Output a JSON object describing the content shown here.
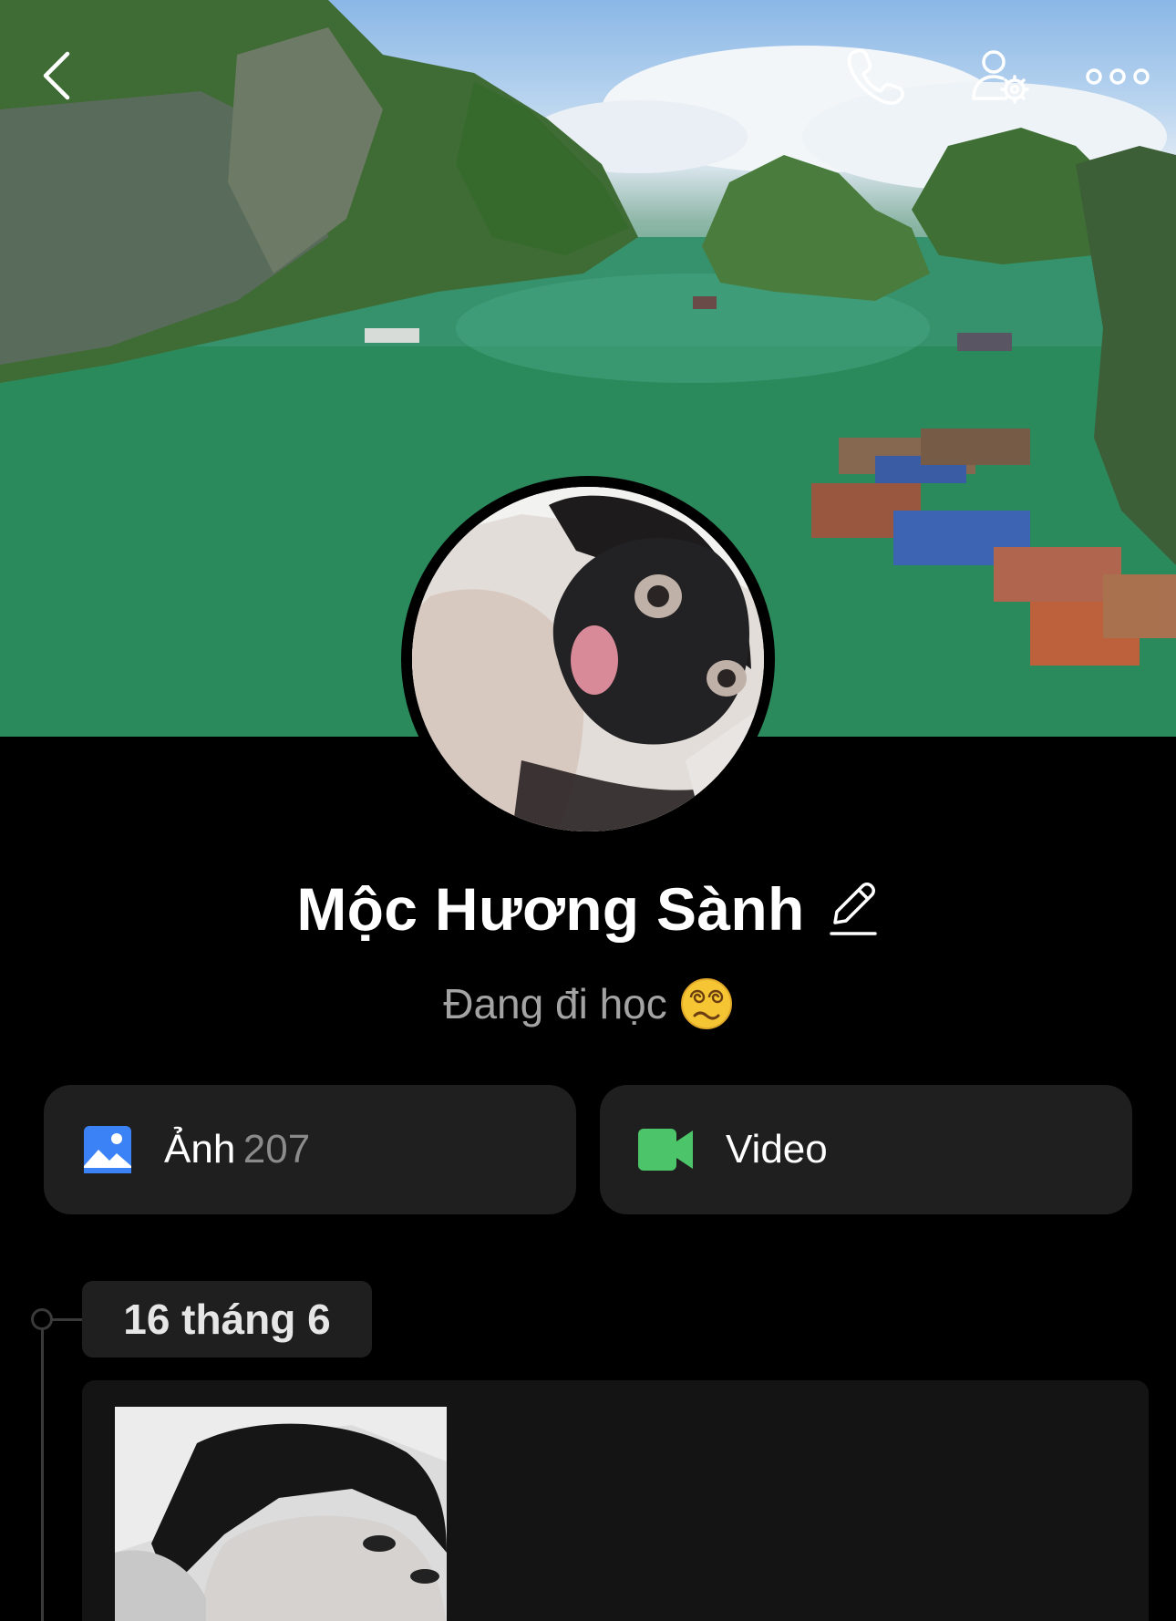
{
  "profile": {
    "name": "Mộc Hương Sành",
    "status": "Đang đi học"
  },
  "topbar": {
    "icons": [
      "chevron-left-icon",
      "phone-icon",
      "user-settings-icon",
      "more-horizontal-icon"
    ]
  },
  "media": {
    "photos_label": "Ảnh",
    "photos_count": "207",
    "videos_label": "Video",
    "photo_icon_color": "#3b82f6",
    "video_icon_color": "#4cc46a"
  },
  "timeline": {
    "date": "16 tháng 6"
  }
}
